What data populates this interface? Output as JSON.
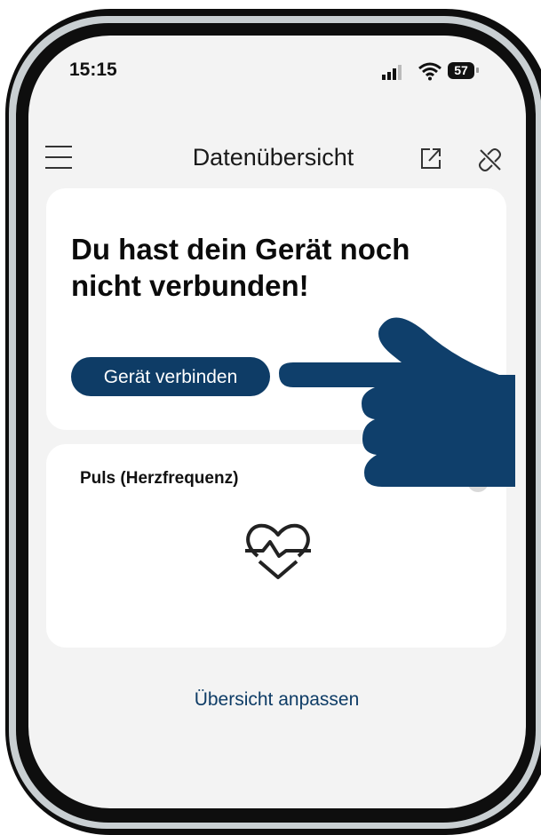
{
  "status_bar": {
    "time": "15:15",
    "battery": "57"
  },
  "header": {
    "title": "Datenübersicht"
  },
  "connect_card": {
    "title": "Du hast dein Gerät noch nicht verbunden!",
    "button_label": "Gerät verbinden"
  },
  "pulse_card": {
    "title": "Puls (Herzfrequenz)"
  },
  "footer": {
    "customize_label": "Übersicht anpassen"
  },
  "icons": {
    "menu": "hamburger-menu-icon",
    "share": "share-icon",
    "unlink": "unlink-icon",
    "heart": "heart-pulse-icon",
    "chevron": "chevron-right-icon",
    "hand": "pointing-hand-icon"
  },
  "colors": {
    "accent": "#0e3c66",
    "screen_bg": "#f3f3f3",
    "card_bg": "#ffffff"
  }
}
